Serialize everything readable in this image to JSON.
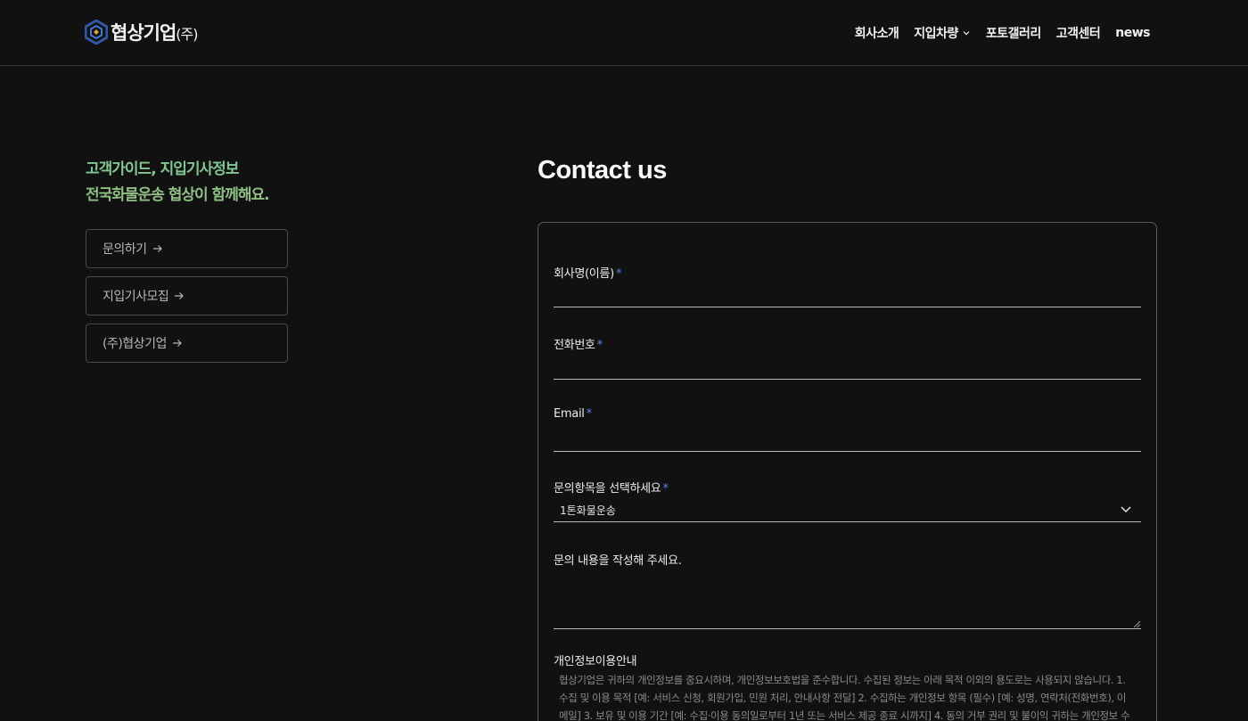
{
  "header": {
    "logo_text": "협상기업",
    "logo_suffix": "(주)",
    "nav": [
      {
        "label": "회사소개"
      },
      {
        "label": "지입차량"
      },
      {
        "label": "포토갤러리"
      },
      {
        "label": "고객센터"
      },
      {
        "label": "news"
      }
    ]
  },
  "sidebar": {
    "tagline_line1": "고객가이드, 지입기사정보",
    "tagline_line2": "전국화물운송 협상이 함께해요.",
    "buttons": [
      {
        "label": "문의하기"
      },
      {
        "label": "지입기사모집"
      },
      {
        "label": "(주)협상기업"
      }
    ]
  },
  "contact": {
    "title": "Contact us",
    "fields": {
      "name_label": "회사명(이름)",
      "phone_label": "전화번호",
      "email_label": "Email",
      "category_label": "문의항목을 선택하세요",
      "category_value": "1톤화물운송",
      "message_label": "문의 내용을 작성해 주세요.",
      "required_mark": "*"
    },
    "privacy_title": "개인정보이용안내",
    "privacy_text": "협상기업은 귀하의 개인정보를 중요시하며, 개인정보보호법을 준수합니다. 수집된 정보는 아래 목적 이외의 용도로는 사용되지 않습니다.   1. 수집 및 이용 목적 [예: 서비스 신청, 회원가입, 민원 처리, 안내사항 전달]  2. 수집하는 개인정보 항목 (필수) [예: 성명, 연락처(전화번호), 이메일]  3. 보유 및 이용 기간 [예: 수집·이용 동의일로부터 1년 또는 서비스 제공 종료 시까지]  4. 동의 거부 권리 및 불이익 귀하는 개인정보 수집 및 이"
  },
  "colors": {
    "background": "#111112",
    "accent_required": "#5b86e5",
    "tagline": "#82c692"
  }
}
